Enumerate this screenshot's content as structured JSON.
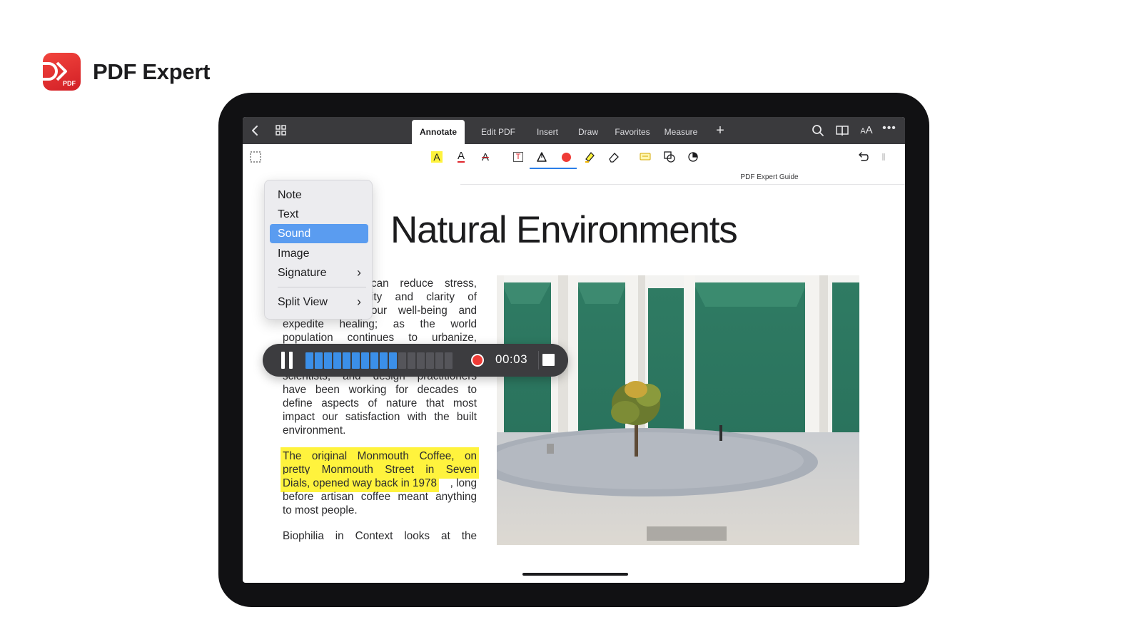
{
  "brand": {
    "name": "PDF Expert",
    "logo_text": "PDF",
    "logo_color": "#e0282e"
  },
  "topbar": {
    "tabs": [
      {
        "label": "Annotate",
        "active": true
      },
      {
        "label": "Edit PDF",
        "active": false
      },
      {
        "label": "Insert",
        "active": false
      },
      {
        "label": "Draw",
        "active": false
      },
      {
        "label": "Favorites",
        "active": false
      },
      {
        "label": "Measure",
        "active": false
      }
    ],
    "text_size_label": "AA",
    "icons": [
      "back-chevron-icon",
      "grid-icon",
      "add-tab-icon",
      "search-icon",
      "book-icon",
      "text-size-icon",
      "more-icon"
    ]
  },
  "toolbar": {
    "tools": [
      "selection-icon",
      "highlight-text-icon",
      "underline-text-icon",
      "strikethrough-text-icon",
      "text-box-icon",
      "pen-icon",
      "record-icon",
      "highlighter-icon",
      "eraser-icon",
      "comment-icon",
      "shapes-icon",
      "stamp-icon",
      "undo-icon"
    ],
    "highlight_glyph": "A",
    "underline_glyph": "A",
    "strike_glyph": "A",
    "textbox_glyph": "T",
    "active_tool": "pen"
  },
  "document": {
    "guide_title": "PDF Expert Guide",
    "heading": "Natural Environments",
    "paragraph1_lines": [
      "can reduce stress,",
      "ity and clarity of",
      "our well-being and",
      "expedite healing; as the world",
      "population continues to urbanize,"
    ],
    "paragraph2_lines": [
      "scientists, and design practitioners",
      "have been working for decades to",
      "define aspects of nature that most",
      "impact our satisfaction with the built",
      "environment."
    ],
    "paragraph3_highlight": [
      "The original Monmouth Coffee, on",
      "pretty Monmouth Street in Seven",
      "Dials, opened way back in 1978"
    ],
    "paragraph3_rest": [
      ", long",
      "before artisan coffee meant anything",
      "to most people."
    ],
    "paragraph4": "Biophilia in Context looks at the",
    "highlight_color": "#fff33d"
  },
  "menu": {
    "items": [
      {
        "label": "Note",
        "selected": false,
        "submenu": false
      },
      {
        "label": "Text",
        "selected": false,
        "submenu": false
      },
      {
        "label": "Sound",
        "selected": true,
        "submenu": false
      },
      {
        "label": "Image",
        "selected": false,
        "submenu": false
      },
      {
        "label": "Signature",
        "selected": false,
        "submenu": true
      },
      {
        "label": "Split View",
        "selected": false,
        "submenu": true
      }
    ],
    "chevron": "›"
  },
  "recorder": {
    "time": "00:03",
    "level_filled": 10,
    "level_total": 16,
    "active_color": "#3b8fe8",
    "inactive_color": "#55555a"
  }
}
